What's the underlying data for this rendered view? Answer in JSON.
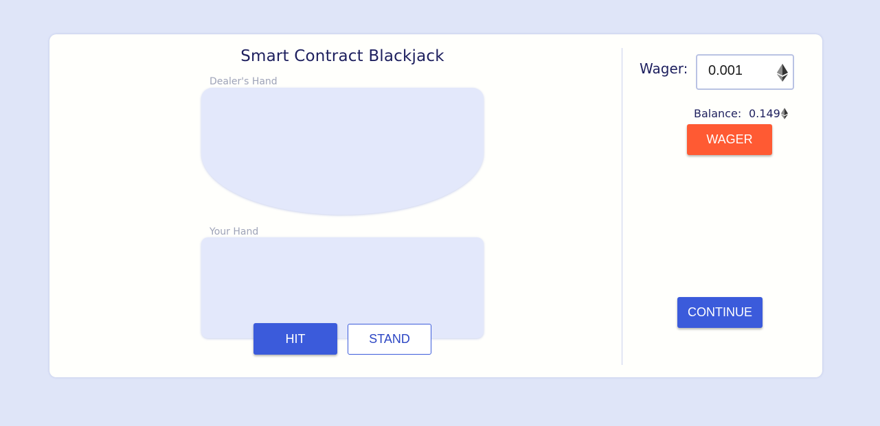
{
  "game": {
    "title": "Smart Contract Blackjack",
    "dealer_hand_label": "Dealer's Hand",
    "your_hand_label": "Your Hand",
    "hit_label": "HIT",
    "stand_label": "STAND"
  },
  "sidebar": {
    "wager_label": "Wager:",
    "wager_value": "0.001",
    "currency_icon": "ethereum-icon",
    "balance_label": "Balance:",
    "balance_value": "0.149",
    "wager_button_label": "WAGER",
    "continue_button_label": "CONTINUE"
  },
  "colors": {
    "background": "#dfe5f8",
    "card": "#fffffc",
    "primary": "#3b5bdb",
    "accent": "#ff5a33",
    "hand_area": "#e3e8fb",
    "title_text": "#1d1f5e"
  }
}
